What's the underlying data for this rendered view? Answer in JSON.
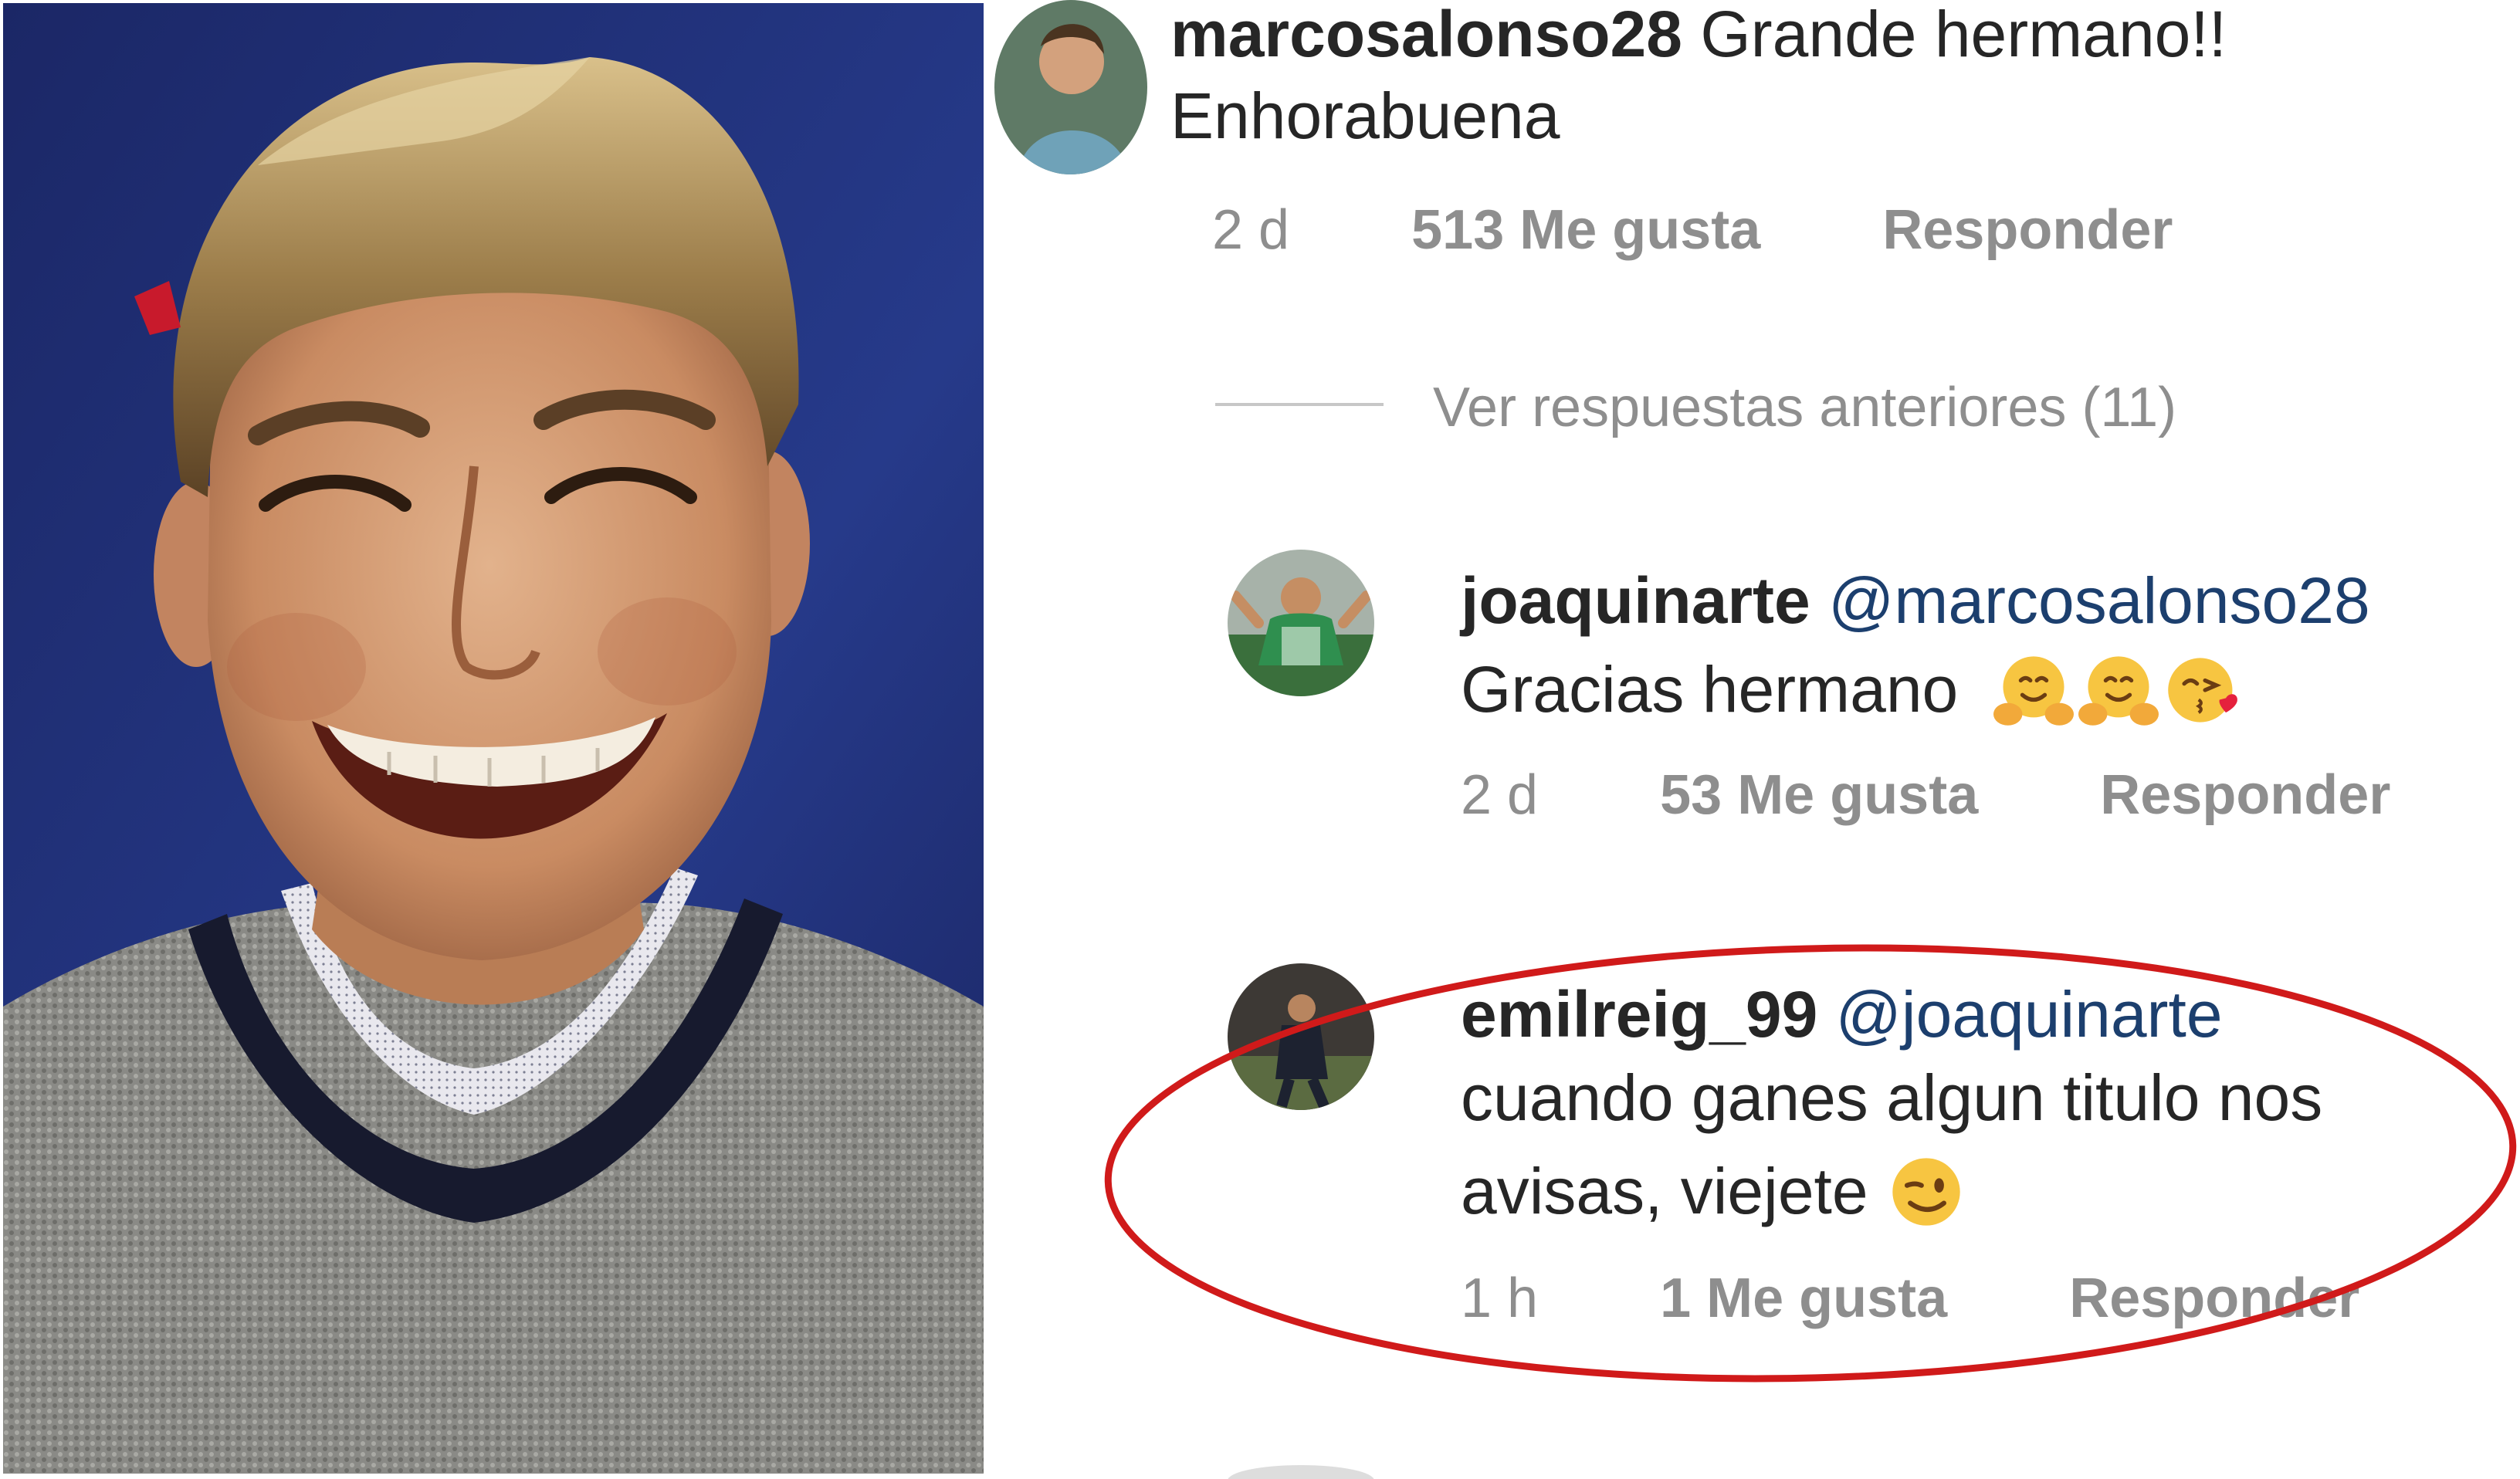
{
  "comments": [
    {
      "username": "marcosalonso28",
      "text_line1": "Grande hermano!!",
      "text_line2": "Enhorabuena",
      "time": "2 d",
      "likes": "513 Me gusta",
      "reply": "Responder",
      "avatar_icon": "user-avatar-photo"
    },
    {
      "username": "joaquinarte",
      "mention": "@marcosalonso28",
      "text": "Gracias hermano",
      "emojis": [
        "hugging-face-emoji",
        "hugging-face-emoji",
        "face-blowing-kiss-emoji"
      ],
      "time": "2 d",
      "likes": "53 Me gusta",
      "reply": "Responder",
      "avatar_icon": "user-avatar-photo"
    },
    {
      "username": "emilreig_99",
      "mention": "@joaquinarte",
      "text_line1": "cuando ganes algun titulo nos",
      "text_line2": "avisas, viejete",
      "emojis": [
        "winking-face-emoji"
      ],
      "time": "1 h",
      "likes": "1 Me gusta",
      "reply": "Responder",
      "avatar_icon": "user-avatar-photo"
    }
  ],
  "view_replies": "Ver respuestas anteriores (11)",
  "colors": {
    "highlight_ellipse": "#d01a1a",
    "photo_background": "#1d2a68",
    "meta_text": "#8e8e8e",
    "mention": "#1c3f6e"
  }
}
